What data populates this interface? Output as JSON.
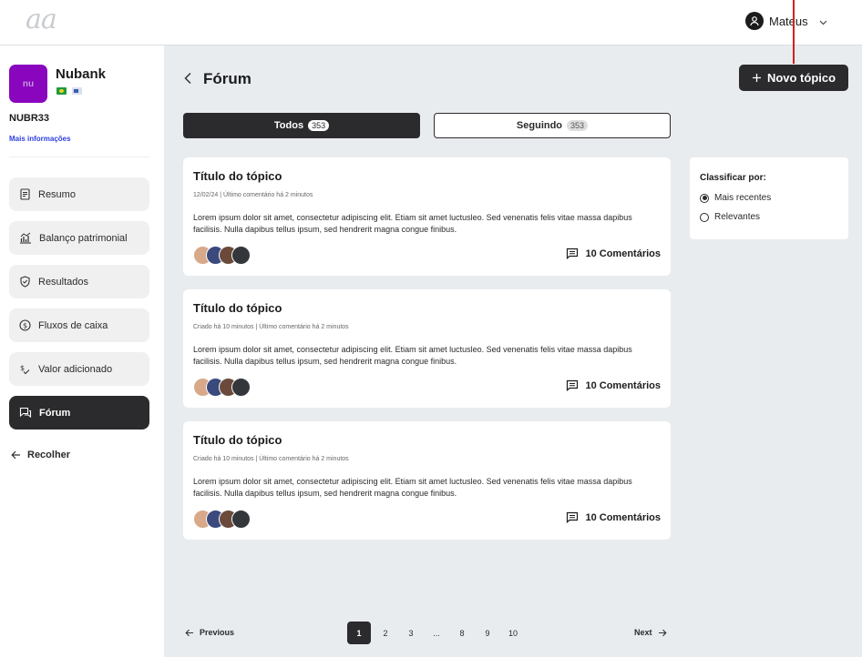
{
  "header": {
    "logo_text": "aa",
    "user_name": "Mateus"
  },
  "company": {
    "logo_text": "nu",
    "name": "Nubank",
    "ticker": "NUBR33",
    "more_info": "Mais informações"
  },
  "sidebar": {
    "items": [
      {
        "label": "Resumo",
        "icon": "document-icon"
      },
      {
        "label": "Balanço patrimonial",
        "icon": "balance-chart-icon"
      },
      {
        "label": "Resultados",
        "icon": "shield-check-icon"
      },
      {
        "label": "Fluxos de caixa",
        "icon": "dollar-circle-icon"
      },
      {
        "label": "Valor adicionado",
        "icon": "value-added-icon"
      },
      {
        "label": "Fórum",
        "icon": "chat-icon",
        "active": true
      }
    ],
    "collapse_label": "Recolher"
  },
  "page": {
    "title": "Fórum",
    "new_topic_label": "Novo tópico"
  },
  "tabs": [
    {
      "label": "Todos",
      "count": "353",
      "active": true
    },
    {
      "label": "Seguindo",
      "count": "353",
      "active": false
    }
  ],
  "topics": [
    {
      "title": "Título do tópico",
      "meta": "12/02/24 | Último comentário há 2 minutos",
      "body": "Lorem ipsum dolor sit amet, consectetur adipiscing elit. Etiam sit amet luctusleo. Sed venenatis felis vitae massa dapibus facilisis. Nulla dapibus tellus ipsum, sed hendrerit magna congue finibus.",
      "comments": "10 Comentários"
    },
    {
      "title": "Título do tópico",
      "meta": "Criado há 10 minutos | Último comentário há 2 minutos",
      "body": "Lorem ipsum dolor sit amet, consectetur adipiscing elit. Etiam sit amet luctusleo. Sed venenatis felis vitae massa dapibus facilisis. Nulla dapibus tellus ipsum, sed hendrerit magna congue finibus.",
      "comments": "10 Comentários"
    },
    {
      "title": "Título do tópico",
      "meta": "Criado há 10 minutos | Último comentário há 2 minutos",
      "body": "Lorem ipsum dolor sit amet, consectetur adipiscing elit. Etiam sit amet luctusleo. Sed venenatis felis vitae massa dapibus facilisis. Nulla dapibus tellus ipsum, sed hendrerit magna congue finibus.",
      "comments": "10 Comentários"
    }
  ],
  "sort": {
    "label": "Classificar por:",
    "options": [
      {
        "label": "Mais recentes",
        "selected": true
      },
      {
        "label": "Relevantes",
        "selected": false
      }
    ]
  },
  "pagination": {
    "previous": "Previous",
    "next": "Next",
    "pages": [
      "1",
      "2",
      "3",
      "...",
      "8",
      "9",
      "10"
    ],
    "current": "1"
  },
  "colors": {
    "accent_dark": "#2b2b2d",
    "brand_purple": "#8a05be",
    "link_blue": "#2d3fe0",
    "annotation_red": "#d21f1f"
  }
}
